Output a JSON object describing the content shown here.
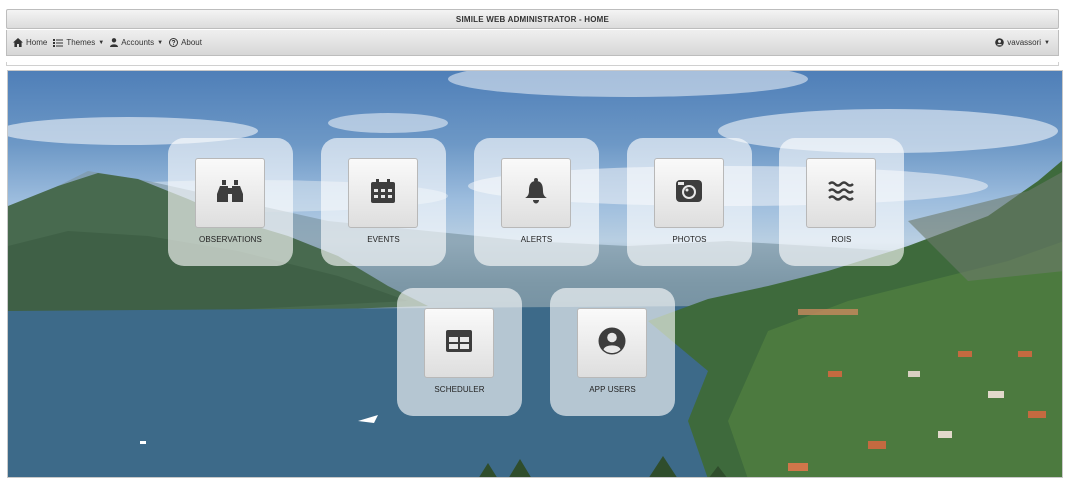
{
  "app": {
    "title": "SIMILE WEB ADMINISTRATOR - HOME"
  },
  "nav": {
    "home": "Home",
    "themes": "Themes",
    "accounts": "Accounts",
    "about": "About",
    "user": "vavassori",
    "caret": "▼"
  },
  "tiles": {
    "observations": {
      "label": "OBSERVATIONS",
      "icon": "binoculars-icon"
    },
    "events": {
      "label": "EVENTS",
      "icon": "calendar-icon"
    },
    "alerts": {
      "label": "ALERTS",
      "icon": "bell-icon"
    },
    "photos": {
      "label": "PHOTOS",
      "icon": "camera-icon"
    },
    "rois": {
      "label": "ROIS",
      "icon": "waves-icon"
    },
    "scheduler": {
      "label": "SCHEDULER",
      "icon": "table-icon"
    },
    "app_users": {
      "label": "APP USERS",
      "icon": "user-circle-icon"
    }
  },
  "colors": {
    "icon": "#3d3d3d",
    "tile_bg": "rgba(255,255,255,0.62)"
  }
}
